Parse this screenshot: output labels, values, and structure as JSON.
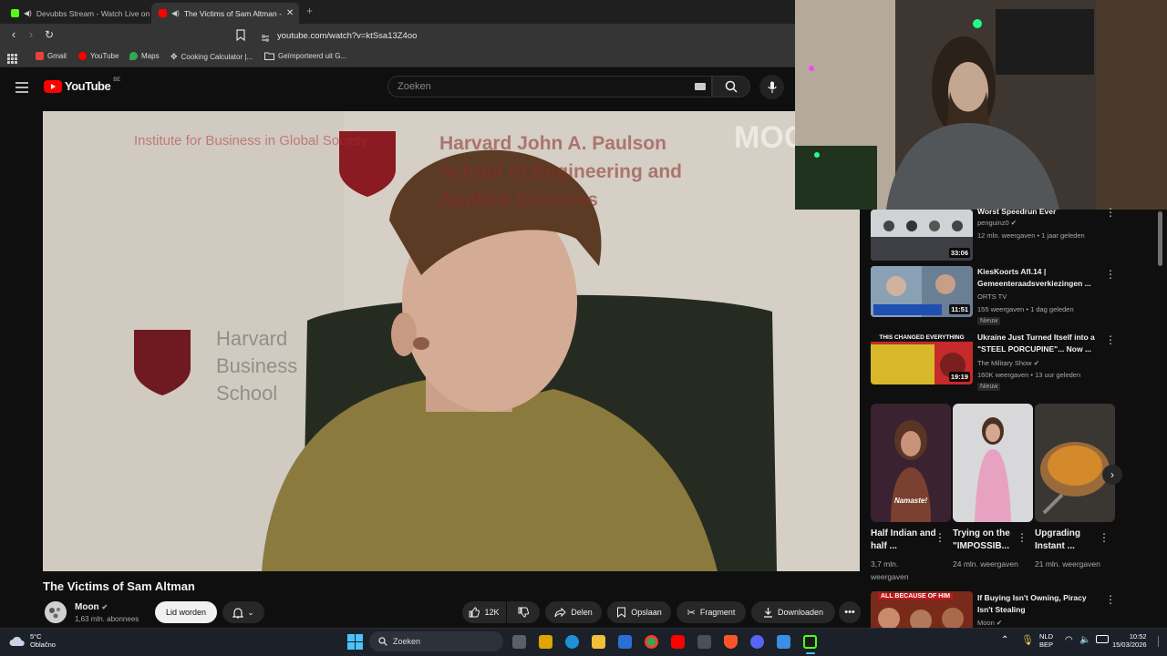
{
  "browser": {
    "tabs": [
      {
        "title": "Devubbs Stream - Watch Live on"
      },
      {
        "title": "The Victims of Sam Altman -"
      }
    ],
    "url": "youtube.com/watch?v=ktSsa13Z4oo",
    "bookmarks": [
      "Gmail",
      "YouTube",
      "Maps",
      "Cooking Calculator |...",
      "Geïmporteerd uit G..."
    ]
  },
  "youtube": {
    "logo_text": "YouTube",
    "region": "BE",
    "search_placeholder": "Zoeken"
  },
  "video": {
    "overlay_texts": [
      "Institute for Business in Global Society",
      "Harvard John A. Paulson School of Engineering and Applied Sciences",
      "Harvard Business School"
    ],
    "watermark": "MOO",
    "title": "The Victims of Sam Altman",
    "channel": "Moon",
    "subscribers": "1,63 mln. abonnees",
    "join_label": "Lid worden",
    "likes": "12K",
    "share_label": "Delen",
    "save_label": "Opslaan",
    "clip_label": "Fragment",
    "download_label": "Downloaden"
  },
  "sidebar": {
    "items": [
      {
        "title": "Worst Speedrun Ever",
        "channel": "penguinz0",
        "meta": "12 mln. weergaven • 1 jaar geleden",
        "duration": "33:06",
        "badge": ""
      },
      {
        "title": "KiesKoorts Afl.14 | Gemeenteraadsverkiezingen ...",
        "channel": "ORTS TV",
        "meta": "155 weergaven • 1 dag geleden",
        "duration": "11:51",
        "badge": "Nieuw"
      },
      {
        "title": "Ukraine Just Turned Itself into a \"STEEL PORCUPINE\"... Now ...",
        "channel": "The Military Show",
        "meta": "160K weergaven • 13 uur geleden",
        "duration": "19:19",
        "badge": "Nieuw",
        "thumb_text": "THIS CHANGED EVERYTHING"
      },
      {
        "title": "If Buying Isn't Owning, Piracy Isn't Stealing",
        "channel": "Moon",
        "meta": "",
        "duration": "",
        "badge": "",
        "thumb_text": "ALL BECAUSE OF HIM"
      }
    ],
    "shorts": [
      {
        "title": "Half Indian and half ...",
        "views": "3,7 mln. weergaven",
        "thumb_text": "Namaste!"
      },
      {
        "title": "Trying on the \"IMPOSSIB...",
        "views": "24 mln. weergaven"
      },
      {
        "title": "Upgrading Instant ...",
        "views": "21 mln. weergaven"
      }
    ]
  },
  "taskbar": {
    "weather_temp": "5°C",
    "weather_desc": "Oblačno",
    "search_label": "Zoeken",
    "lang_top": "NLD",
    "lang_bottom": "BEP",
    "time": "10:52",
    "date": "15/03/2026"
  },
  "colors": {
    "youtube_red": "#ff0000",
    "background": "#0f0f0f",
    "taskbar": "#1c2129"
  }
}
